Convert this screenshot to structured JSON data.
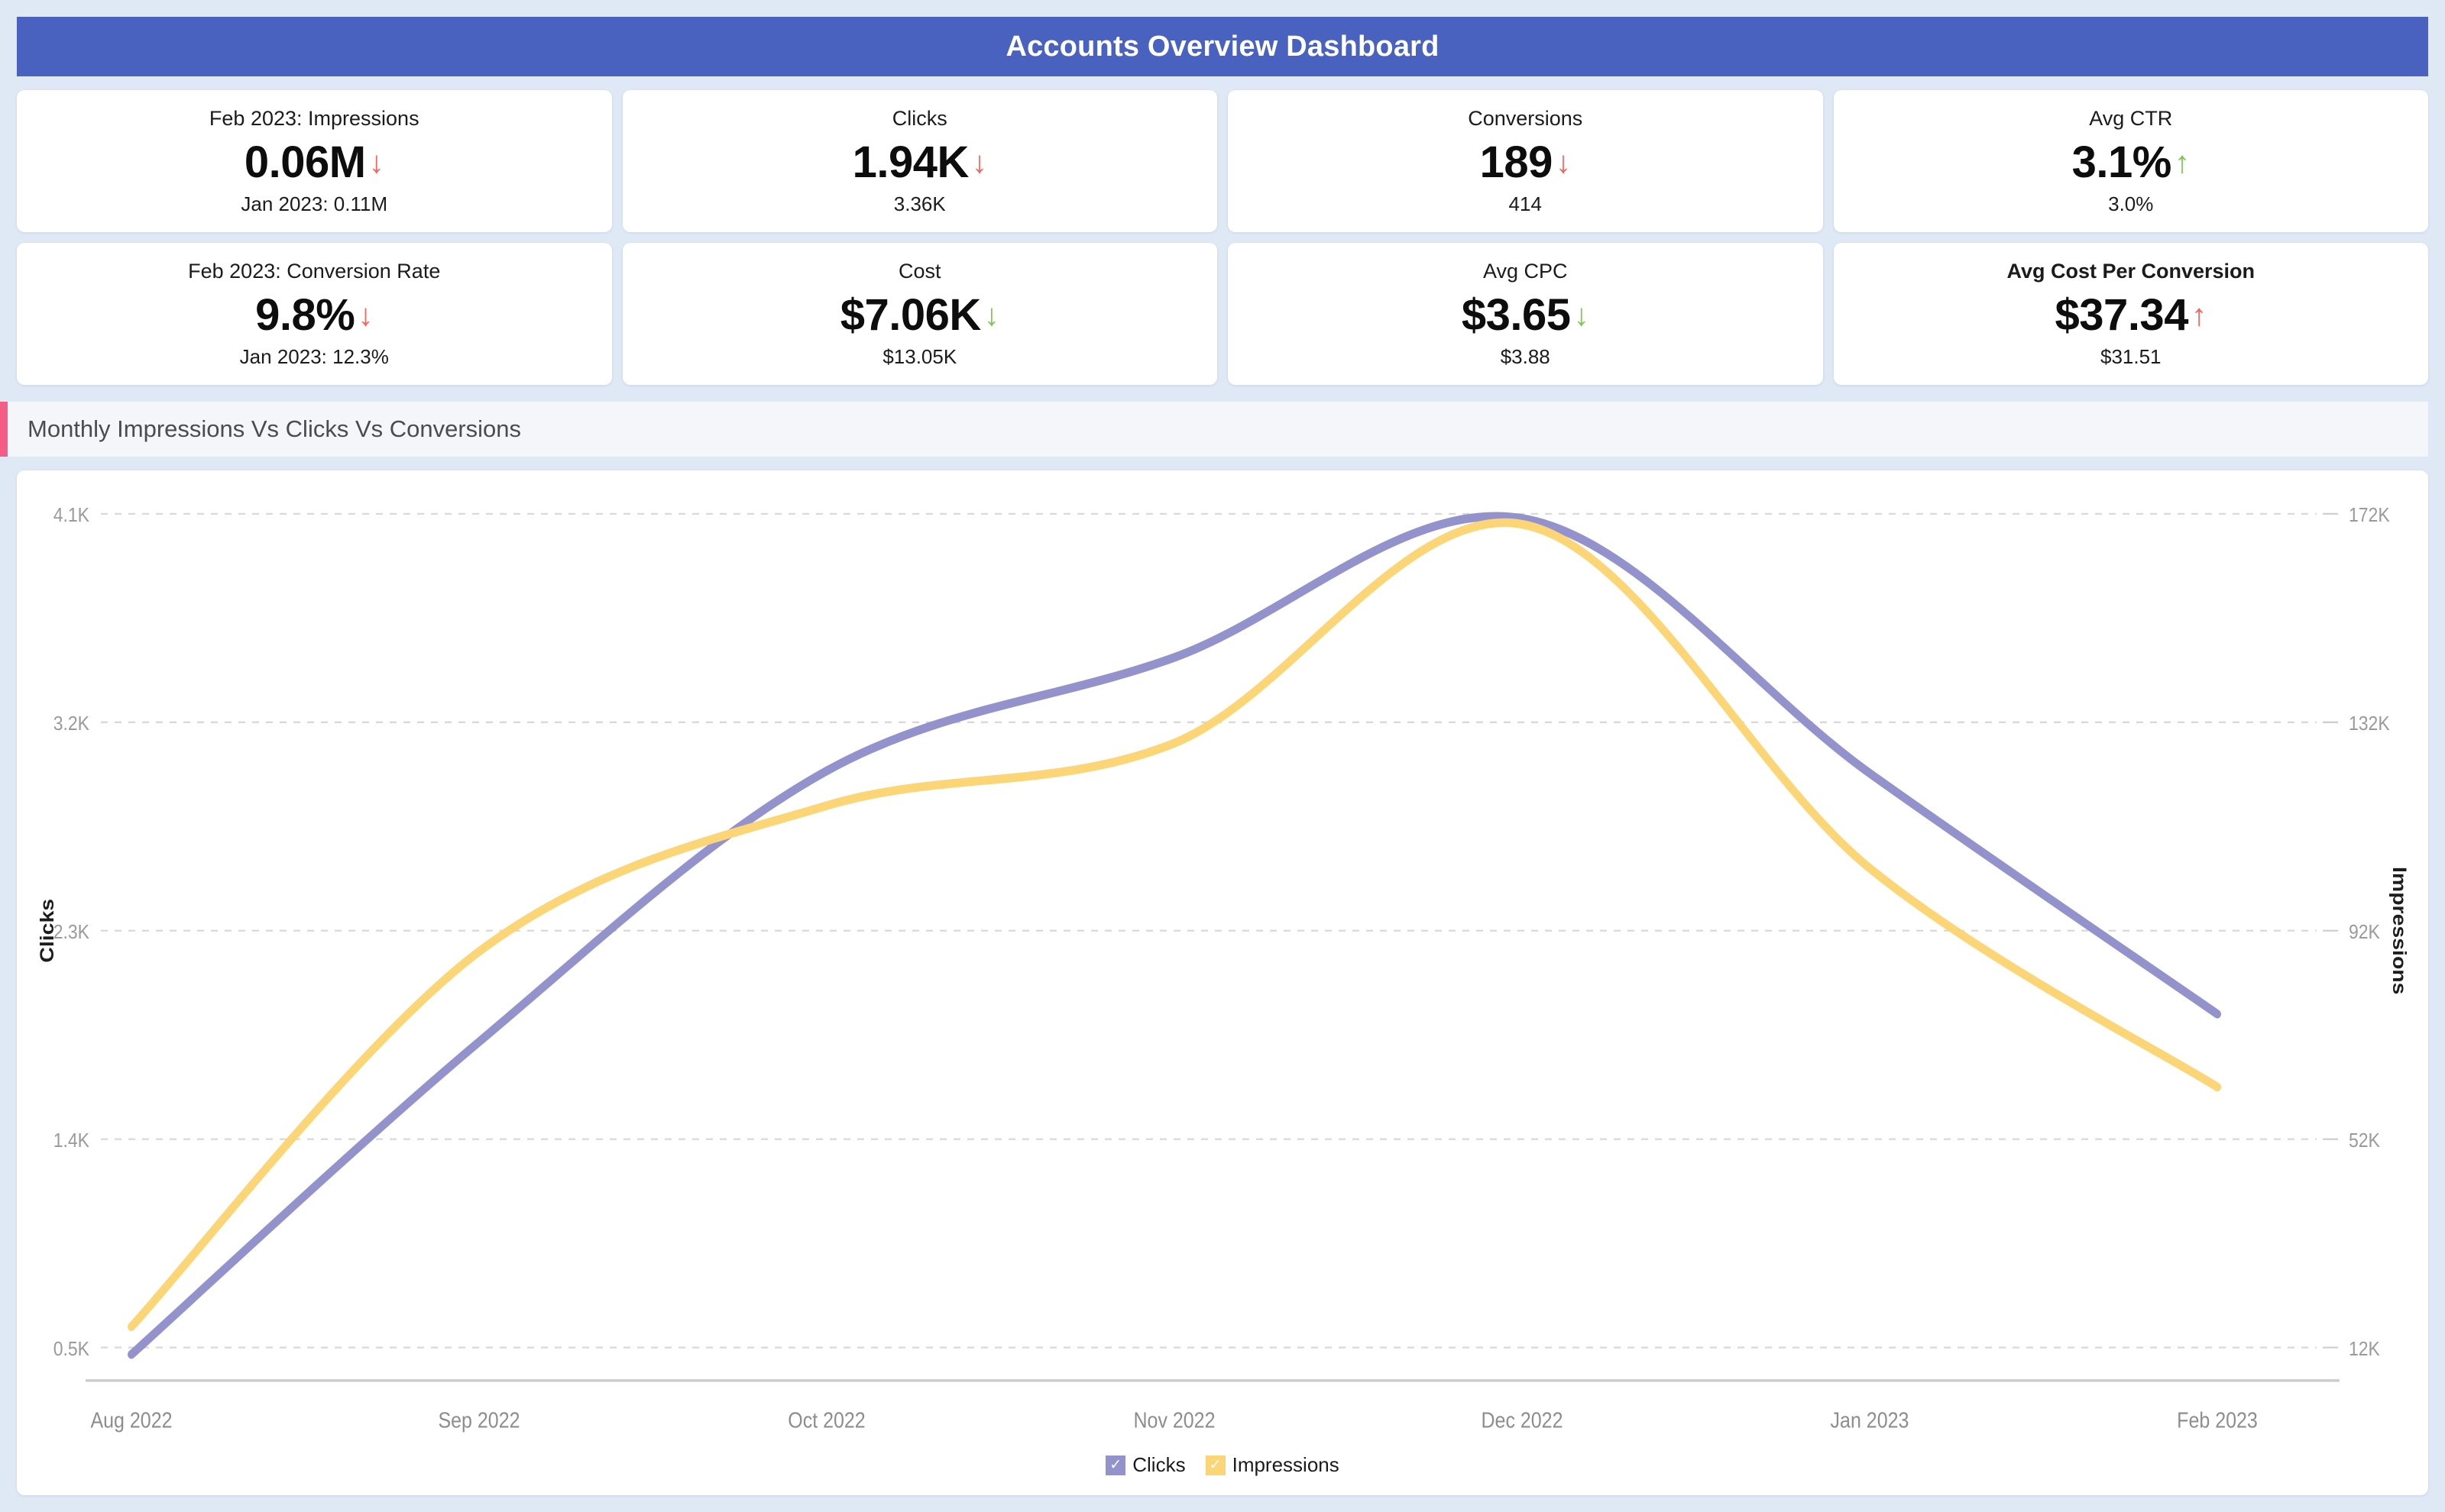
{
  "header": {
    "title": "Accounts Overview Dashboard",
    "bar_color": "#4a62bf"
  },
  "kpis": [
    {
      "label": "Feb 2023: Impressions",
      "label_bold": false,
      "value": "0.06M",
      "arrow": "down",
      "arrow_tone": "bad",
      "prev": "Jan 2023: 0.11M"
    },
    {
      "label": "Clicks",
      "label_bold": false,
      "value": "1.94K",
      "arrow": "down",
      "arrow_tone": "bad",
      "prev": "3.36K"
    },
    {
      "label": "Conversions",
      "label_bold": false,
      "value": "189",
      "arrow": "down",
      "arrow_tone": "bad",
      "prev": "414"
    },
    {
      "label": "Avg CTR",
      "label_bold": false,
      "value": "3.1%",
      "arrow": "up",
      "arrow_tone": "good",
      "prev": "3.0%"
    },
    {
      "label": "Feb 2023: Conversion Rate",
      "label_bold": false,
      "value": "9.8%",
      "arrow": "down",
      "arrow_tone": "bad",
      "prev": "Jan 2023: 12.3%"
    },
    {
      "label": "Cost",
      "label_bold": false,
      "value": "$7.06K",
      "arrow": "down",
      "arrow_tone": "good",
      "prev": "$13.05K"
    },
    {
      "label": "Avg CPC",
      "label_bold": false,
      "value": "$3.65",
      "arrow": "down",
      "arrow_tone": "good",
      "prev": "$3.88"
    },
    {
      "label": "Avg Cost Per Conversion",
      "label_bold": true,
      "value": "$37.34",
      "arrow": "up",
      "arrow_tone": "bad",
      "prev": "$31.51"
    }
  ],
  "section": {
    "title": "Monthly Impressions Vs Clicks Vs Conversions",
    "accent_color": "#f45e86"
  },
  "chart_data": {
    "type": "line",
    "title": "Monthly Impressions Vs Clicks Vs Conversions",
    "x": [
      "Aug 2022",
      "Sep 2022",
      "Oct 2022",
      "Nov 2022",
      "Dec 2022",
      "Jan 2023",
      "Feb 2023"
    ],
    "xlabel": "",
    "grid": true,
    "legend_position": "bottom",
    "axes": {
      "left": {
        "label": "Clicks",
        "ticks": [
          "0.5K",
          "1.4K",
          "2.3K",
          "3.2K",
          "4.1K"
        ],
        "tick_values": [
          500,
          1400,
          2300,
          3200,
          4100
        ],
        "range": [
          500,
          4100
        ]
      },
      "right": {
        "label": "Impressions",
        "ticks": [
          "12K",
          "52K",
          "92K",
          "132K",
          "172K"
        ],
        "tick_values": [
          12000,
          52000,
          92000,
          132000,
          172000
        ],
        "range": [
          12000,
          172000
        ]
      }
    },
    "series": [
      {
        "name": "Clicks",
        "axis": "left",
        "color": "#9392cd",
        "values": [
          470,
          1820,
          2990,
          3480,
          4080,
          2980,
          1940
        ]
      },
      {
        "name": "Impressions",
        "axis": "right",
        "color": "#fcd577",
        "values": [
          16000,
          88000,
          116000,
          128000,
          170000,
          104000,
          62000
        ]
      }
    ],
    "legend": [
      {
        "label": "Clicks",
        "color": "#9392cd",
        "checked": true
      },
      {
        "label": "Impressions",
        "color": "#fcd577",
        "checked": true
      }
    ]
  }
}
